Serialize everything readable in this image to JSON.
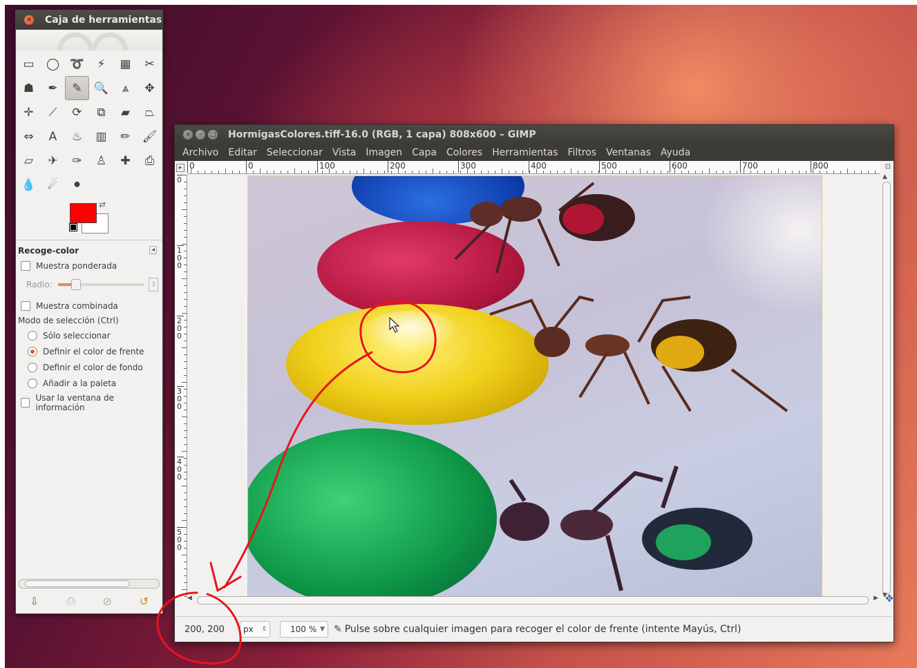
{
  "toolbox": {
    "title": "Caja de herramientas",
    "tools": [
      {
        "name": "rect-select-icon",
        "glyph": "▭"
      },
      {
        "name": "ellipse-select-icon",
        "glyph": "◯"
      },
      {
        "name": "lasso-select-icon",
        "glyph": "➰"
      },
      {
        "name": "fuzzy-select-icon",
        "glyph": "⚡"
      },
      {
        "name": "select-by-color-icon",
        "glyph": "▦"
      },
      {
        "name": "scissors-icon",
        "glyph": "✂"
      },
      {
        "name": "foreground-select-icon",
        "glyph": "☗"
      },
      {
        "name": "paths-icon",
        "glyph": "✒"
      },
      {
        "name": "color-picker-icon",
        "glyph": "✎",
        "active": true
      },
      {
        "name": "zoom-icon",
        "glyph": "🔍"
      },
      {
        "name": "measure-icon",
        "glyph": "⩓"
      },
      {
        "name": "move-icon",
        "glyph": "✥"
      },
      {
        "name": "align-icon",
        "glyph": "✛"
      },
      {
        "name": "crop-icon",
        "glyph": "⟋"
      },
      {
        "name": "rotate-icon",
        "glyph": "⟳"
      },
      {
        "name": "scale-icon",
        "glyph": "⧉"
      },
      {
        "name": "shear-icon",
        "glyph": "▰"
      },
      {
        "name": "perspective-icon",
        "glyph": "⏢"
      },
      {
        "name": "flip-icon",
        "glyph": "⇔"
      },
      {
        "name": "text-icon",
        "glyph": "A"
      },
      {
        "name": "bucket-fill-icon",
        "glyph": "♨"
      },
      {
        "name": "blend-icon",
        "glyph": "▥"
      },
      {
        "name": "pencil-icon",
        "glyph": "✏"
      },
      {
        "name": "paintbrush-icon",
        "glyph": "🖌"
      },
      {
        "name": "eraser-icon",
        "glyph": "▱"
      },
      {
        "name": "airbrush-icon",
        "glyph": "✈"
      },
      {
        "name": "ink-icon",
        "glyph": "✑"
      },
      {
        "name": "clone-icon",
        "glyph": "♙"
      },
      {
        "name": "heal-icon",
        "glyph": "✚"
      },
      {
        "name": "perspective-clone-icon",
        "glyph": "⎙"
      },
      {
        "name": "blur-icon",
        "glyph": "💧"
      },
      {
        "name": "smudge-icon",
        "glyph": "☄"
      },
      {
        "name": "dodge-burn-icon",
        "glyph": "⚫"
      }
    ],
    "fg_color": "#ff0000",
    "bg_color": "#ffffff",
    "options": {
      "title": "Recoge-color",
      "sample_average": "Muestra ponderada",
      "radius_label": "Radio:",
      "radius_value": "3",
      "radius_fraction": 0.2,
      "sample_merged": "Muestra combinada",
      "pick_mode_label": "Modo de selección  (Ctrl)",
      "modes": [
        {
          "label": "Sólo seleccionar",
          "selected": false
        },
        {
          "label": "Definir el color de frente",
          "selected": true
        },
        {
          "label": "Definir el color de fondo",
          "selected": false
        },
        {
          "label": "Añadir a la paleta",
          "selected": false
        }
      ],
      "use_info_window": "Usar la ventana de información"
    }
  },
  "window": {
    "title": "HormigasColores.tiff-16.0 (RGB, 1 capa) 808x600 – GIMP",
    "menu": [
      "Archivo",
      "Editar",
      "Seleccionar",
      "Vista",
      "Imagen",
      "Capa",
      "Colores",
      "Herramientas",
      "Filtros",
      "Ventanas",
      "Ayuda"
    ],
    "hruler_labels": [
      "0",
      "0",
      "100",
      "200",
      "300",
      "400",
      "500",
      "600",
      "700",
      "800"
    ],
    "vruler_labels": [
      "0",
      "100",
      "200",
      "300",
      "400",
      "500"
    ],
    "status": {
      "coords": "200, 200",
      "unit": "px",
      "zoom": "100 %",
      "message": "Pulse sobre cualquier imagen para recoger el color de frente (intente Mayús, Ctrl)"
    }
  },
  "annotation_color": "#e8141c"
}
